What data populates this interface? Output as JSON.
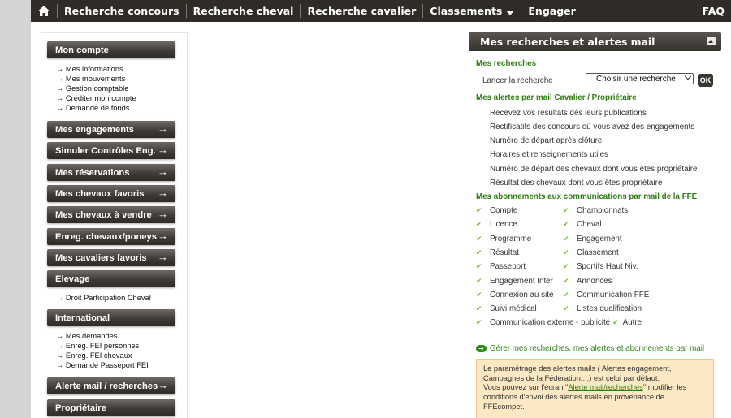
{
  "nav": {
    "items": [
      "Recherche concours",
      "Recherche cheval",
      "Recherche cavalier",
      "Classements",
      "Engager"
    ],
    "faq": "FAQ"
  },
  "sidebar": {
    "mon_compte": "Mon compte",
    "mon_compte_links": [
      "→ Mes informations",
      "→ Mes mouvements",
      "→ Gestion comptable",
      "→ Créditer mon compte",
      "→ Demande de fonds"
    ],
    "engagements": "Mes engagements",
    "simuler": "Simuler Contrôles Eng.",
    "reservations": "Mes réservations",
    "chevaux_favoris": "Mes chevaux favoris",
    "chevaux_vendre": "Mes chevaux à vendre",
    "enreg": "Enreg. chevaux/poneys",
    "cavaliers_favoris": "Mes cavaliers favoris",
    "elevage": "Elevage",
    "elevage_links": [
      "→ Droit Participation Cheval"
    ],
    "international": "International",
    "international_links": [
      "→ Mes demandes",
      "→ Enreg. FEI personnes",
      "→ Enreg. FEI chevaux",
      "→ Demande Passeport FEI"
    ],
    "alerte": "Alerte mail / recherches",
    "proprietaire": "Propriétaire",
    "arrow": "→"
  },
  "panel": {
    "title": "Mes recherches et alertes mail",
    "recherches_heading": "Mes recherches",
    "lancer_label": "Lancer la recherche",
    "select_value": "Choisir une recherche",
    "ok_label": "OK",
    "alertes_heading": "Mes alertes par mail Cavalier / Propriétaire",
    "alertes": [
      "Recevez vos résultats dès leurs publications",
      "Rectificatifs des concours où vous avez des engagements",
      "Numéro de départ après clôture",
      "Horaires et renseignements utiles",
      "Numéro de départ des chevaux dont vous êtes propriétaire",
      "Résultat des chevaux dont vous êtes propriétaire"
    ],
    "abonnements_heading": "Mes abonnements aux communications par mail de la FFE",
    "abonnements_left": [
      "Compte",
      "Licence",
      "Programme",
      "Résultat",
      "Passeport",
      "Engagement Inter",
      "Connexion au site",
      "Suivi médical"
    ],
    "abonnements_right": [
      "Championnats",
      "Cheval",
      "Engagement",
      "Classement",
      "Sportifs Haut Niv.",
      "Annonces",
      "Communication FFE",
      "Listes qualification"
    ],
    "communication_externe": "Communication externe - publicité",
    "autre": "Autre",
    "manage_link": "Gérer mes recherches, mes alertes et abonnements par mail",
    "info_line1": "Le paramétrage des alertes mails ( Alertes engagement,",
    "info_line2": "Campagnes de la Fédération,...) est celui par défaut.",
    "info_line3_pre": "Vous pouvez sur l'écran \"",
    "info_line3_link": "Alerte mail/recherches",
    "info_line3_post": "\" modifier les",
    "info_line4": "conditions d'envoi des alertes mails en provenance de",
    "info_line5": "FFEcompet."
  }
}
